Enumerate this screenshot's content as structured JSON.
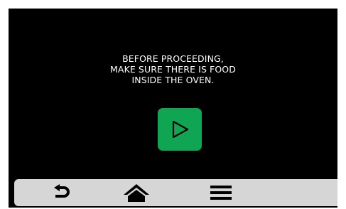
{
  "screen": {
    "message_lines": [
      "BEFORE PROCEEDING,",
      "MAKE SURE THERE IS FOOD",
      "INSIDE THE OVEN."
    ],
    "start_button": {
      "icon": "play-icon",
      "color": "#10a552"
    }
  },
  "bottom_bar": {
    "items": [
      {
        "icon": "back-arrow-icon"
      },
      {
        "icon": "home-icon"
      },
      {
        "icon": "menu-icon"
      }
    ]
  },
  "colors": {
    "background": "#000000",
    "text": "#ffffff",
    "accent": "#10a552",
    "bar": "#d6d6d6"
  }
}
